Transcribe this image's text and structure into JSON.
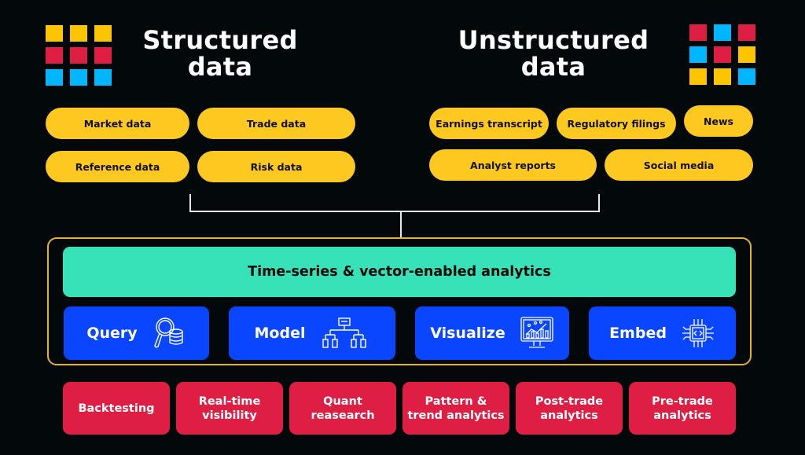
{
  "structured": {
    "title_line1": "Structured",
    "title_line2": "data",
    "grid_colors": [
      "#fdc400",
      "#fdc400",
      "#fdc400",
      "#de1f43",
      "#de1f43",
      "#de1f43",
      "#00b7ff",
      "#00b7ff",
      "#00b7ff"
    ],
    "sources": [
      "Market data",
      "Trade data",
      "Reference data",
      "Risk data"
    ]
  },
  "unstructured": {
    "title_line1": "Unstructured",
    "title_line2": "data",
    "grid_colors": [
      "#de1f43",
      "#00b7ff",
      "#de1f43",
      "#00b7ff",
      "#de1f43",
      "#fdc400",
      "#fdc400",
      "#fdc400",
      "#00b7ff"
    ],
    "sources": [
      "Earnings transcript",
      "Regulatory filings",
      "News",
      "Analyst reports",
      "Social media"
    ]
  },
  "platform": {
    "banner": "Time-series & vector-enabled analytics",
    "capabilities": [
      {
        "label": "Query",
        "icon": "magnifier-database-icon"
      },
      {
        "label": "Model",
        "icon": "hierarchy-icon"
      },
      {
        "label": "Visualize",
        "icon": "monitor-chart-icon"
      },
      {
        "label": "Embed",
        "icon": "chip-code-icon"
      }
    ]
  },
  "use_cases": [
    "Backtesting",
    "Real-time\nvisibility",
    "Quant\nreasearch",
    "Pattern &\ntrend analytics",
    "Post-trade\nanalytics",
    "Pre-trade\nanalytics"
  ],
  "colors": {
    "background": "#03080b",
    "source_pill": "#fdc820",
    "banner": "#38e2b8",
    "capability": "#0a46ff",
    "use_case": "#de1f43",
    "frame": "#e6b422"
  }
}
